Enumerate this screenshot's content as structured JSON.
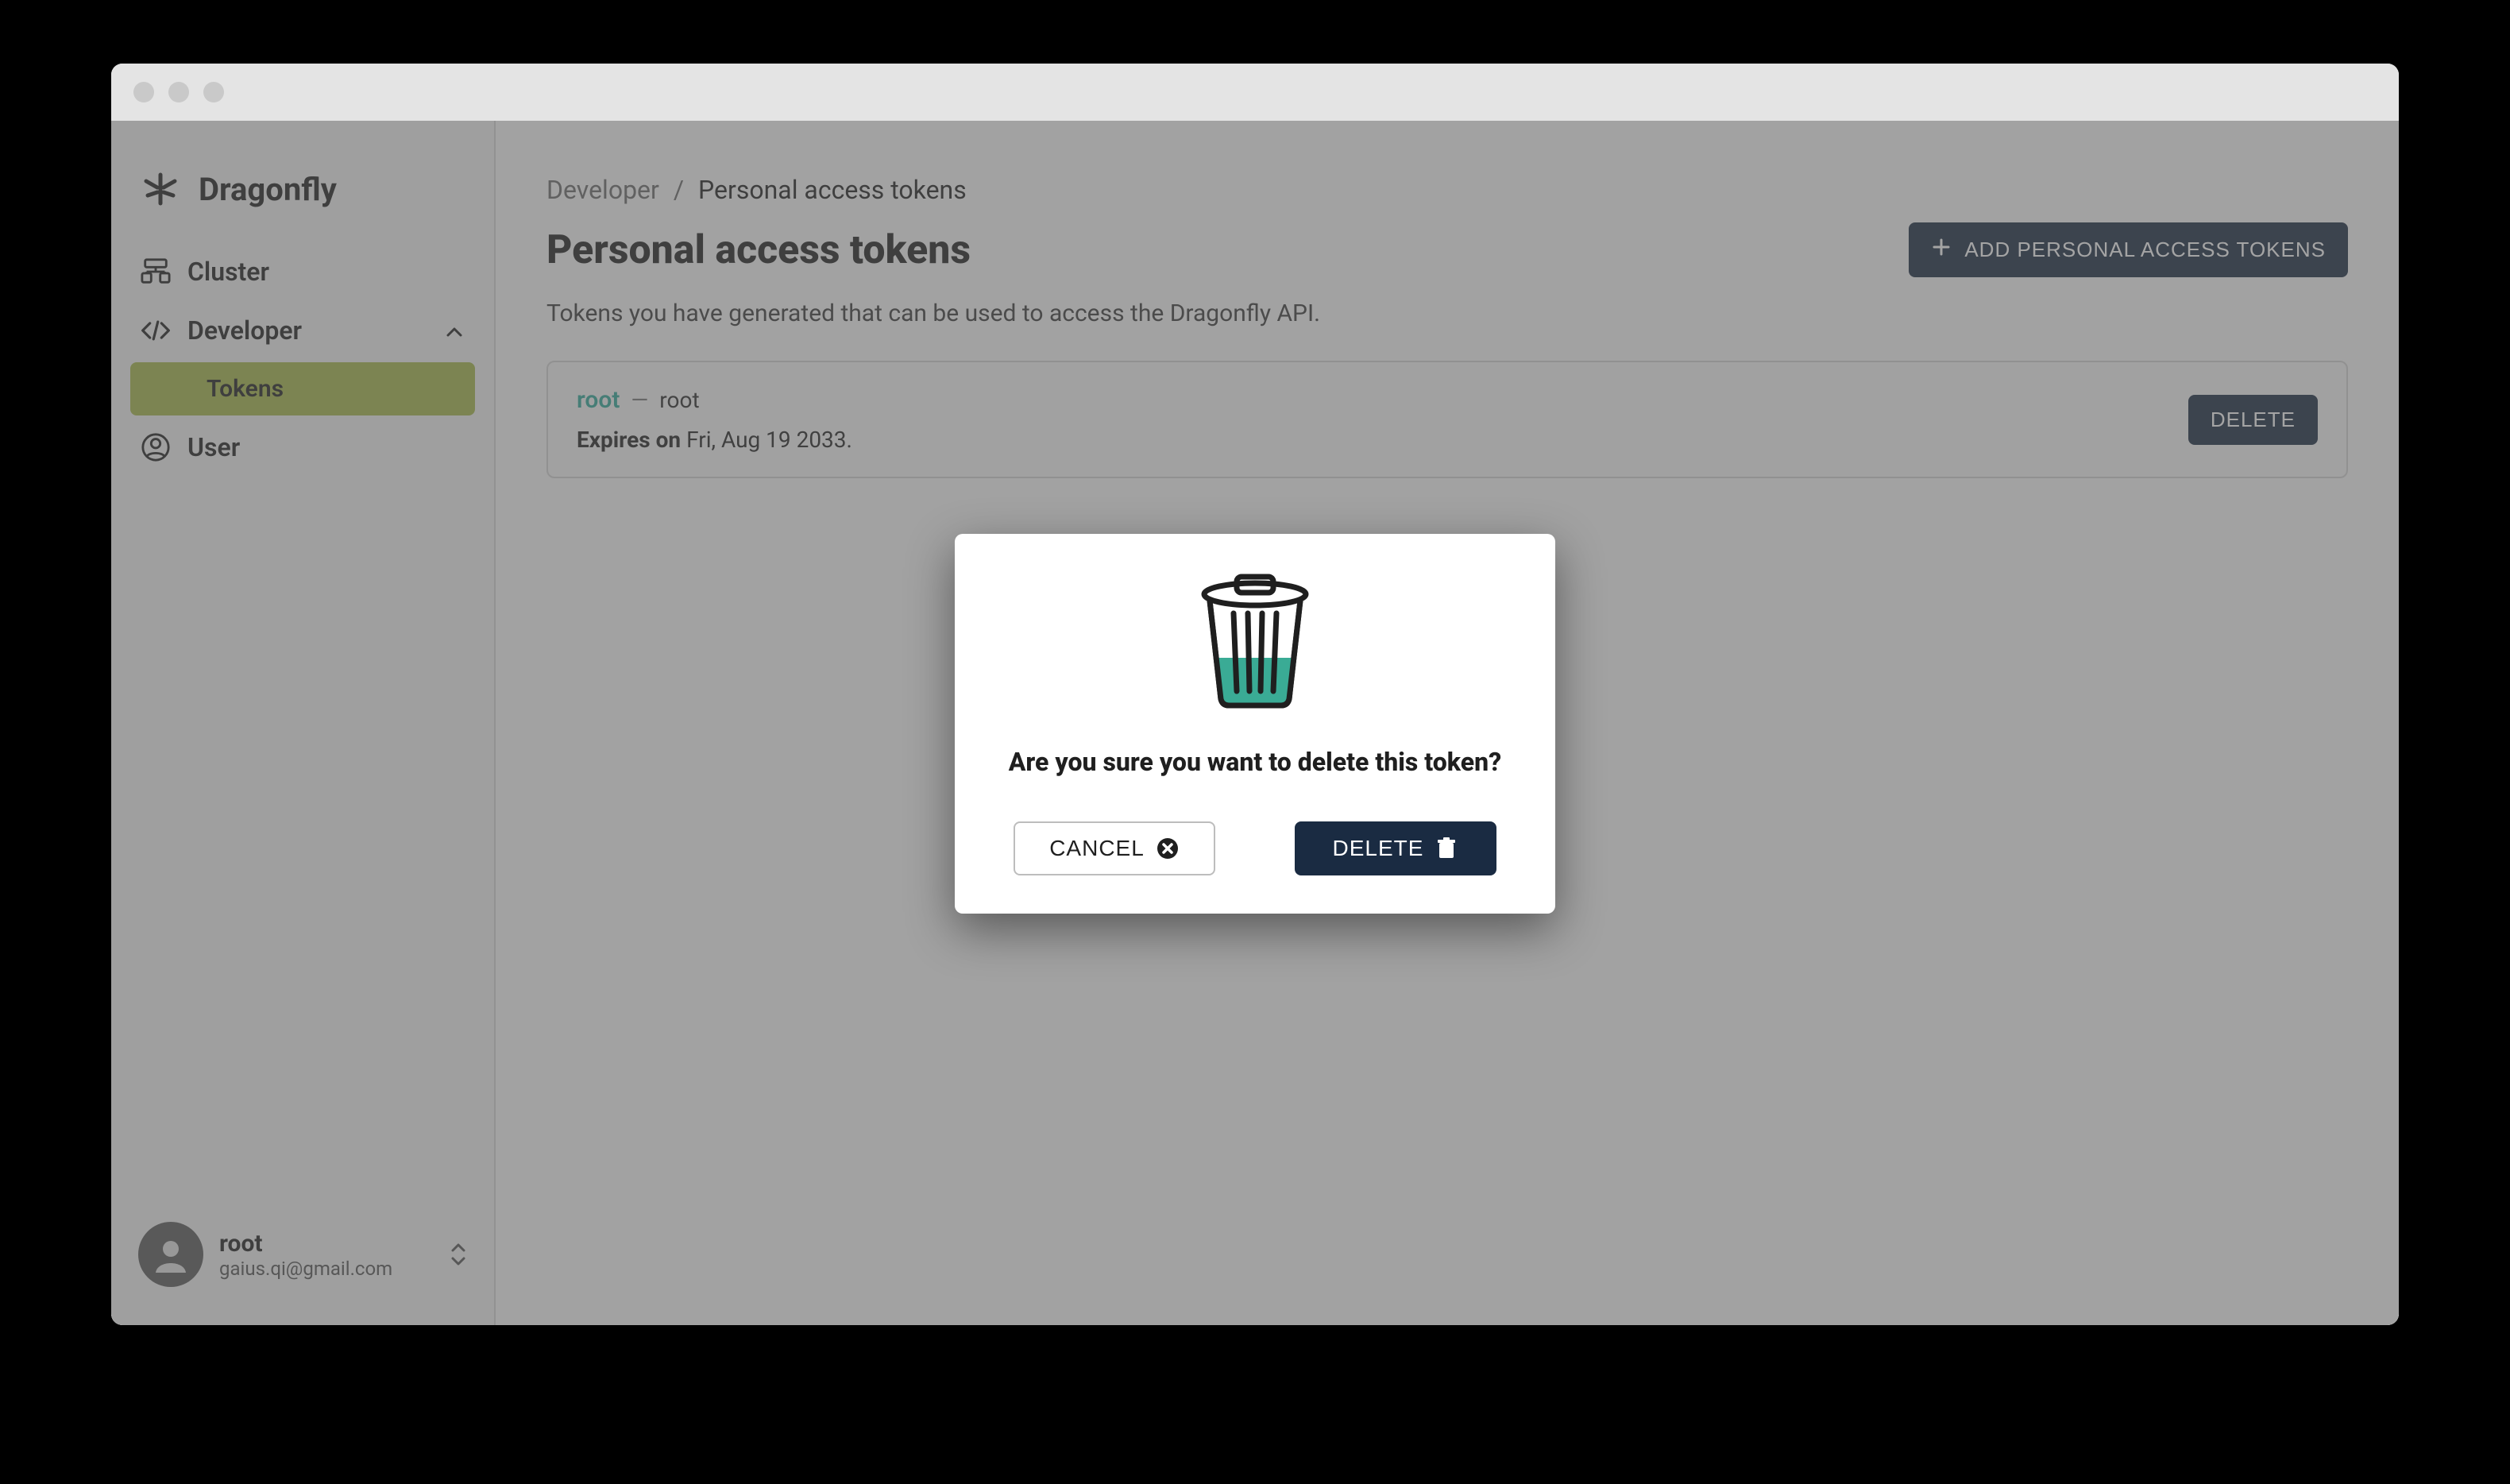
{
  "app": {
    "name": "Dragonfly"
  },
  "sidebar": {
    "items": [
      {
        "label": "Cluster"
      },
      {
        "label": "Developer"
      },
      {
        "label": "User"
      }
    ],
    "subitems": [
      {
        "label": "Tokens"
      }
    ],
    "user": {
      "name": "root",
      "email": "gaius.qi@gmail.com"
    }
  },
  "breadcrumb": {
    "crumb1": "Developer",
    "separator": "/",
    "crumb2": "Personal access tokens"
  },
  "page": {
    "title": "Personal access tokens",
    "description": "Tokens you have generated that can be used to access the Dragonfly API.",
    "add_button": "ADD PERSONAL ACCESS TOKENS"
  },
  "token": {
    "name": "root",
    "dash": "—",
    "desc": "root",
    "expires_label": "Expires on",
    "expires_date": "Fri, Aug 19 2033.",
    "delete_label": "DELETE"
  },
  "modal": {
    "title": "Are you sure you want to delete this token?",
    "cancel_label": "CANCEL",
    "confirm_label": "DELETE"
  }
}
